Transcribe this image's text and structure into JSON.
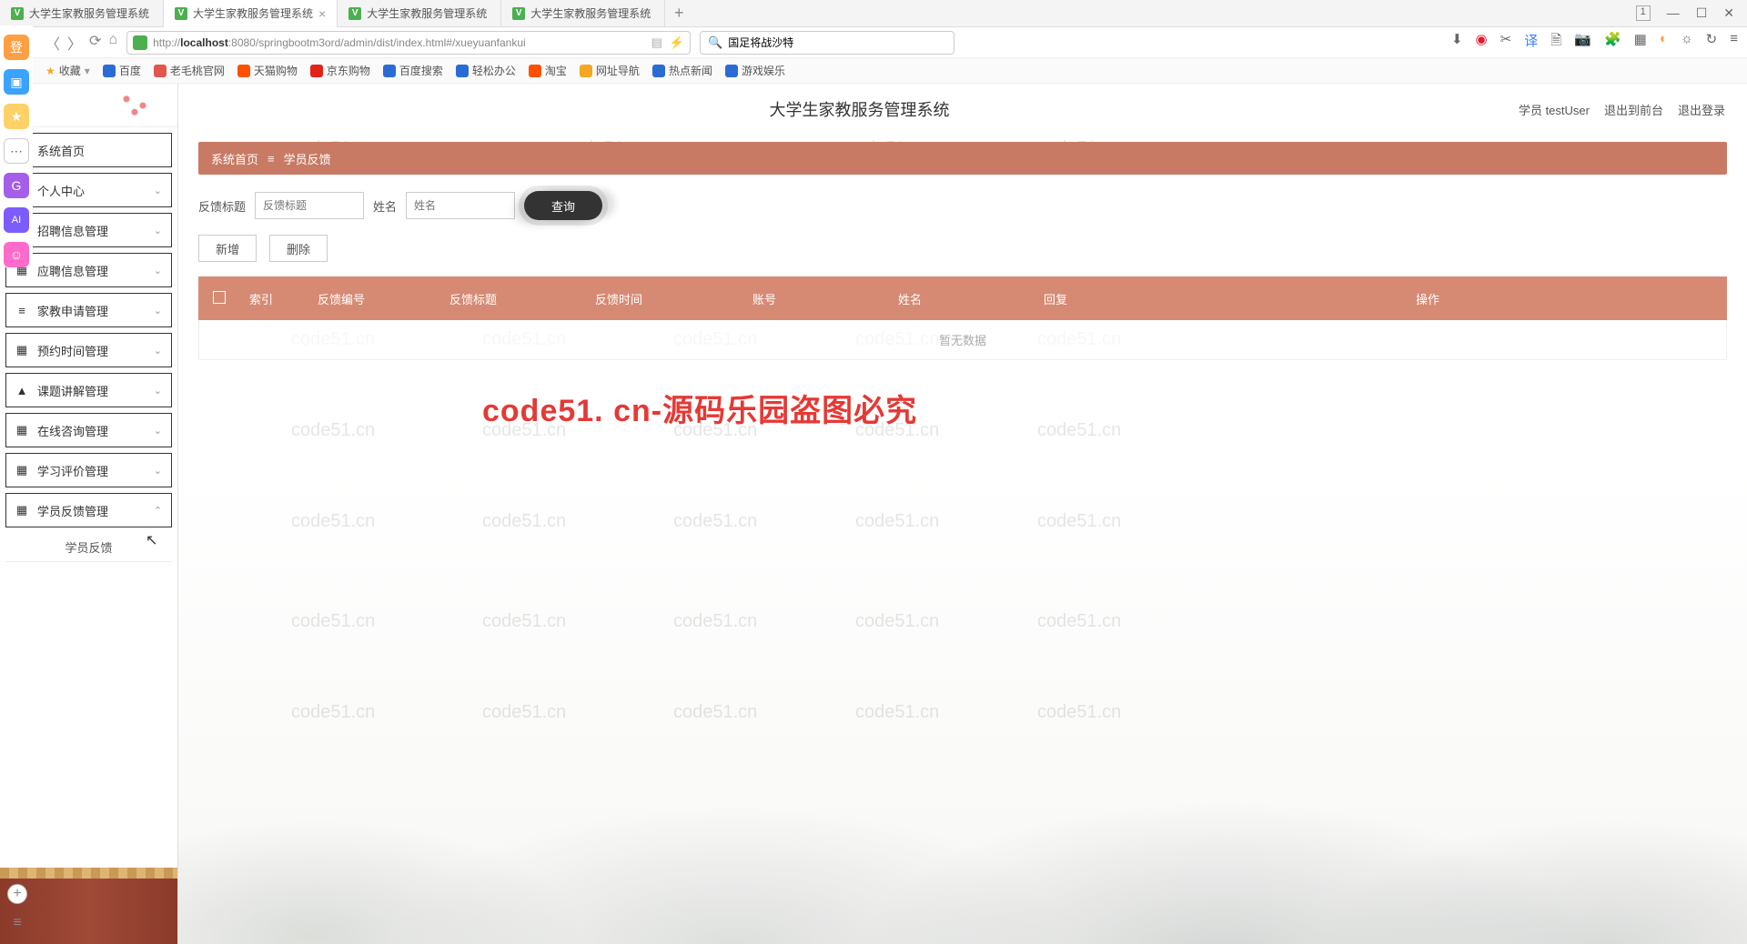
{
  "tabs": [
    {
      "label": "大学生家教服务管理系统",
      "active": false
    },
    {
      "label": "大学生家教服务管理系统",
      "active": true
    },
    {
      "label": "大学生家教服务管理系统",
      "active": false
    },
    {
      "label": "大学生家教服务管理系统",
      "active": false
    }
  ],
  "window_controls": {
    "restore_hint": "1"
  },
  "address": {
    "url_prefix": "http://",
    "url_host": "localhost",
    "url_rest": ":8080/springbootm3ord/admin/dist/index.html#/xueyuanfankui"
  },
  "search": {
    "placeholder": "国足将战沙特"
  },
  "bookmarks": [
    {
      "label": "收藏",
      "color": "#f5a623"
    },
    {
      "label": "百度",
      "color": "#2b6cd4"
    },
    {
      "label": "老毛桃官网",
      "color": "#e2574c"
    },
    {
      "label": "天猫购物",
      "color": "#ff5000"
    },
    {
      "label": "京东购物",
      "color": "#e2231a"
    },
    {
      "label": "百度搜索",
      "color": "#2b6cd4"
    },
    {
      "label": "轻松办公",
      "color": "#2b6cd4"
    },
    {
      "label": "淘宝",
      "color": "#ff5000"
    },
    {
      "label": "网址导航",
      "color": "#f5a623"
    },
    {
      "label": "热点新闻",
      "color": "#2b6cd4"
    },
    {
      "label": "游戏娱乐",
      "color": "#2b6cd4"
    }
  ],
  "header": {
    "title": "大学生家教服务管理系统",
    "user_prefix": "学员 ",
    "user": "testUser",
    "link_front": "退出到前台",
    "link_logout": "退出登录"
  },
  "breadcrumb": {
    "home": "系统首页",
    "sep": "≡",
    "current": "学员反馈"
  },
  "filters": {
    "label1": "反馈标题",
    "placeholder1": "反馈标题",
    "label2": "姓名",
    "placeholder2": "姓名",
    "query": "查询"
  },
  "actions": {
    "add": "新增",
    "del": "删除"
  },
  "table": {
    "col_idx": "索引",
    "col1": "反馈编号",
    "col2": "反馈标题",
    "col3": "反馈时间",
    "col4": "账号",
    "col5": "姓名",
    "col6": "回复",
    "col7": "操作",
    "empty": "暂无数据"
  },
  "sidebar": {
    "items": [
      {
        "icon": "⌂",
        "label": "系统首页",
        "expandable": false
      },
      {
        "icon": "☰",
        "label": "个人中心",
        "expandable": true
      },
      {
        "icon": "▦",
        "label": "招聘信息管理",
        "expandable": true
      },
      {
        "icon": "▦",
        "label": "应聘信息管理",
        "expandable": true
      },
      {
        "icon": "≡",
        "label": "家教申请管理",
        "expandable": true
      },
      {
        "icon": "▦",
        "label": "预约时间管理",
        "expandable": true
      },
      {
        "icon": "▲",
        "label": "课题讲解管理",
        "expandable": true
      },
      {
        "icon": "▦",
        "label": "在线咨询管理",
        "expandable": true
      },
      {
        "icon": "▦",
        "label": "学习评价管理",
        "expandable": true
      },
      {
        "icon": "▦",
        "label": "学员反馈管理",
        "expandable": true
      }
    ],
    "sub": "学员反馈"
  },
  "watermark": "code51.cn",
  "big_watermark": "code51. cn-源码乐园盗图必究",
  "dock": [
    {
      "bg": "#ff9f43",
      "txt": "登"
    },
    {
      "bg": "#3aa3ff",
      "txt": "▣"
    },
    {
      "bg": "#ffd166",
      "txt": "★"
    },
    {
      "bg": "#fff",
      "txt": "⋯",
      "border": true
    },
    {
      "bg": "#a55eea",
      "txt": "G"
    },
    {
      "bg": "#7c5cff",
      "txt": "AI"
    },
    {
      "bg": "#ff6bcb",
      "txt": "☺"
    }
  ]
}
